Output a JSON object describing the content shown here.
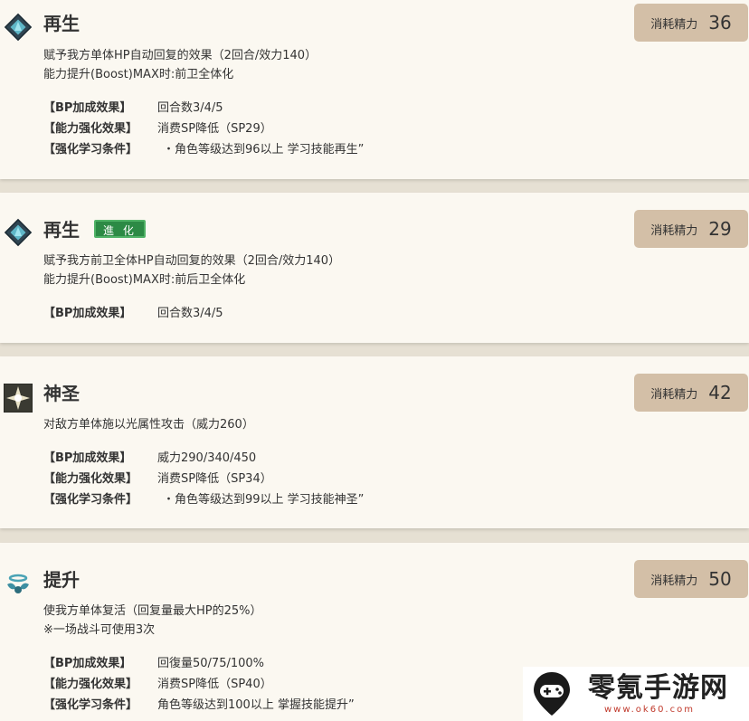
{
  "skills": [
    {
      "name": "再生",
      "cost_label": "消耗精力",
      "cost": "36",
      "desc": [
        "赋予我方单体HP自动回复的效果（2回合/效力140）",
        "能力提升(Boost)MAX时:前卫全体化"
      ],
      "attrs": [
        {
          "key": "【BP加成效果】",
          "value": "回合数3/4/5"
        },
        {
          "key": "【能力强化效果】",
          "value": "消费SP降低（SP29）"
        },
        {
          "key": "【强化学习条件】",
          "value": "・角色等级达到96以上 学习技能再生”"
        }
      ]
    },
    {
      "name": "再生",
      "badge": "進 化",
      "cost_label": "消耗精力",
      "cost": "29",
      "desc": [
        "赋予我方前卫全体HP自动回复的效果（2回合/效力140）",
        "能力提升(Boost)MAX时:前后卫全体化"
      ],
      "attrs": [
        {
          "key": "【BP加成效果】",
          "value": "回合数3/4/5"
        }
      ]
    },
    {
      "name": "神圣",
      "cost_label": "消耗精力",
      "cost": "42",
      "desc": [
        "对敌方单体施以光属性攻击（威力260）"
      ],
      "attrs": [
        {
          "key": "【BP加成效果】",
          "value": "威力290/340/450"
        },
        {
          "key": "【能力强化效果】",
          "value": "消费SP降低（SP34）"
        },
        {
          "key": "【强化学习条件】",
          "value": "・角色等级达到99以上 学习技能神圣”"
        }
      ]
    },
    {
      "name": "提升",
      "cost_label": "消耗精力",
      "cost": "50",
      "desc": [
        "使我方单体复活（回复量最大HP的25%）",
        "※一场战斗可使用3次"
      ],
      "attrs": [
        {
          "key": "【BP加成效果】",
          "value": "回復量50/75/100%"
        },
        {
          "key": "【能力强化效果】",
          "value": "消费SP降低（SP40）"
        },
        {
          "key": "【强化学习条件】",
          "value": "角色等级达到100以上 掌握技能提升”"
        }
      ]
    }
  ],
  "watermark": {
    "text": "零氪手游网",
    "url": "www.ok60.com"
  },
  "icons": {
    "regen": "crystal-shard-icon",
    "holy": "holy-star-icon",
    "raise": "angel-wings-icon",
    "logo": "gamepad-pin-icon"
  },
  "colors": {
    "card_bg": "#fbf8f1",
    "cost_bg": "#d3bfa7",
    "badge_green": "#2c8a45"
  }
}
